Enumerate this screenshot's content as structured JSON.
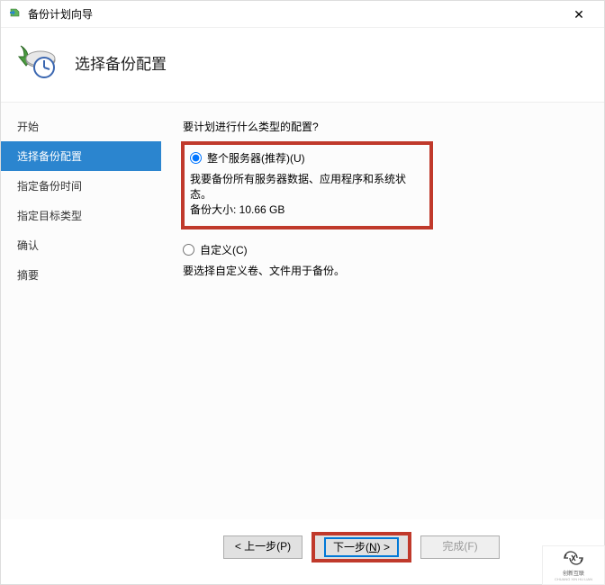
{
  "window": {
    "title": "备份计划向导"
  },
  "header": {
    "page_title": "选择备份配置"
  },
  "sidebar": {
    "items": [
      {
        "label": "开始",
        "active": false
      },
      {
        "label": "选择备份配置",
        "active": true
      },
      {
        "label": "指定备份时间",
        "active": false
      },
      {
        "label": "指定目标类型",
        "active": false
      },
      {
        "label": "确认",
        "active": false
      },
      {
        "label": "摘要",
        "active": false
      }
    ]
  },
  "content": {
    "prompt": "要计划进行什么类型的配置?",
    "option1": {
      "label": "整个服务器(推荐)(U)",
      "desc1": "我要备份所有服务器数据、应用程序和系统状态。",
      "desc2_prefix": "备份大小: ",
      "desc2_value": "10.66 GB"
    },
    "option2": {
      "label": "自定义(C)",
      "desc": "要选择自定义卷、文件用于备份。"
    }
  },
  "footer": {
    "prev": "< 上一步(P)",
    "next_prefix": "下一步(",
    "next_key": "N",
    "next_suffix": ") >",
    "finish": "完成(F)"
  },
  "watermark": {
    "brand": "创新互联",
    "sub": "CHUANG XIN HU LIAN"
  }
}
